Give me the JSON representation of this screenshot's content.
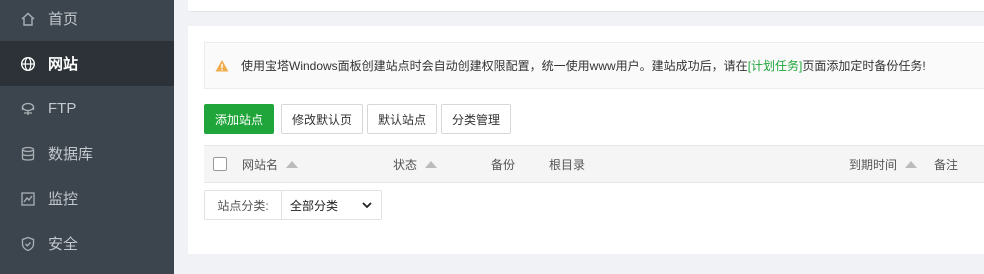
{
  "sidebar": {
    "items": [
      {
        "label": "首页",
        "icon": "home-icon",
        "active": false
      },
      {
        "label": "网站",
        "icon": "globe-icon",
        "active": true
      },
      {
        "label": "FTP",
        "icon": "ftp-icon",
        "active": false
      },
      {
        "label": "数据库",
        "icon": "database-icon",
        "active": false
      },
      {
        "label": "监控",
        "icon": "monitor-icon",
        "active": false
      },
      {
        "label": "安全",
        "icon": "shield-icon",
        "active": false
      }
    ]
  },
  "notice": {
    "text_before": "使用宝塔Windows面板创建站点时会自动创建权限配置，统一使用www用户。建站成功后，请在",
    "link": "[计划任务]",
    "text_after": "页面添加定时备份任务!"
  },
  "toolbar": {
    "add_site": "添加站点",
    "edit_default_page": "修改默认页",
    "default_site": "默认站点",
    "category_manage": "分类管理"
  },
  "table": {
    "columns": {
      "site_name": "网站名",
      "status": "状态",
      "backup": "备份",
      "root_dir": "根目录",
      "expire_time": "到期时间",
      "remark": "备注"
    }
  },
  "filter": {
    "label": "站点分类:",
    "selected": "全部分类"
  },
  "colors": {
    "sidebar_bg": "#3c444d",
    "sidebar_active_bg": "#2c3238",
    "accent": "#20a53a",
    "warning": "#f0ad4e"
  }
}
